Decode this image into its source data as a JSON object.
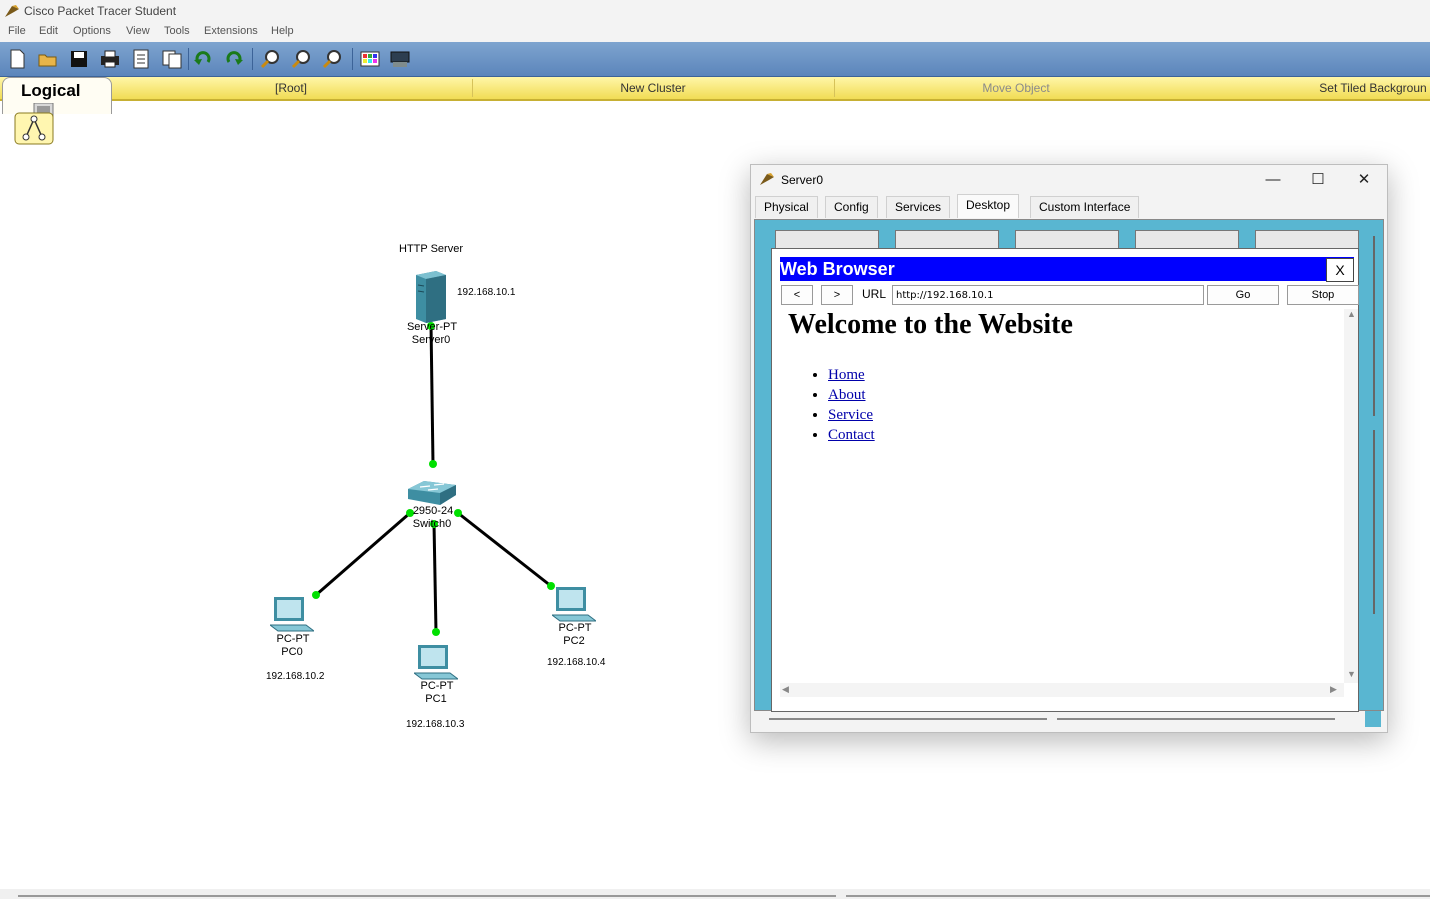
{
  "app": {
    "title": "Cisco Packet Tracer Student"
  },
  "menu": [
    "File",
    "Edit",
    "Options",
    "View",
    "Tools",
    "Extensions",
    "Help"
  ],
  "toolbar_icons": [
    "new-file-icon",
    "open-folder-icon",
    "save-icon",
    "print-icon",
    "activity-wizard-icon",
    "pdu-list-icon",
    "undo-icon",
    "redo-icon",
    "zoom-in-icon",
    "zoom-reset-icon",
    "zoom-out-icon",
    "palette-icon",
    "custom-device-icon"
  ],
  "logical_bar": {
    "tab": "Logical",
    "root": "[Root]",
    "new_cluster": "New Cluster",
    "move_object": "Move Object",
    "set_tiled_background": "Set Tiled Backgroun"
  },
  "topology": {
    "server_note": "HTTP Server",
    "server": {
      "type": "Server-PT",
      "name": "Server0",
      "ip": "192.168.10.1"
    },
    "switch": {
      "type": "2950-24",
      "name": "Switch0"
    },
    "pcs": [
      {
        "type": "PC-PT",
        "name": "PC0",
        "ip": "192.168.10.2"
      },
      {
        "type": "PC-PT",
        "name": "PC1",
        "ip": "192.168.10.3"
      },
      {
        "type": "PC-PT",
        "name": "PC2",
        "ip": "192.168.10.4"
      }
    ],
    "link_status_color": "#00e000"
  },
  "server_window": {
    "title": "Server0",
    "tabs": [
      "Physical",
      "Config",
      "Services",
      "Desktop",
      "Custom Interface"
    ],
    "active_tab": "Desktop",
    "browser": {
      "title": "Web Browser",
      "close": "X",
      "back": "<",
      "forward": ">",
      "url_label": "URL",
      "url": "http://192.168.10.1",
      "go": "Go",
      "stop": "Stop",
      "heading": "Welcome to the Website",
      "links": [
        "Home",
        "About",
        "Service",
        "Contact"
      ]
    }
  },
  "colors": {
    "toolbar": "#5b85bb",
    "logical_bar": "#f1dc55",
    "desktop_bg": "#59b6d1",
    "browser_titlebar": "#0000ff"
  }
}
